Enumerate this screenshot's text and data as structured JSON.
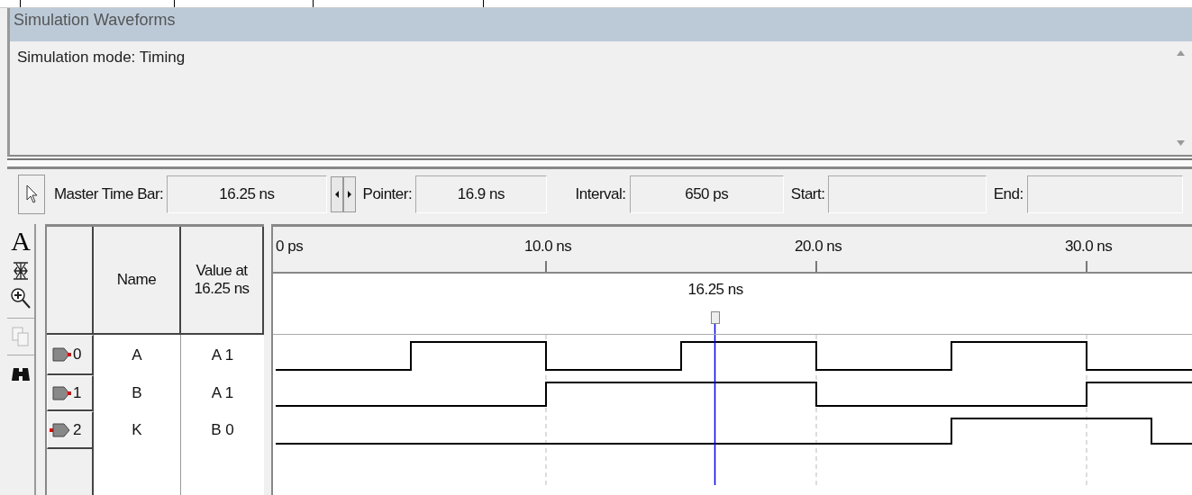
{
  "panel": {
    "title": "Simulation Waveforms"
  },
  "messages": [
    "Simulation mode: Timing"
  ],
  "time_bar": {
    "master_label": "Master Time Bar:",
    "master_value": "16.25 ns",
    "pointer_label": "Pointer:",
    "pointer_value": "16.9 ns",
    "interval_label": "Interval:",
    "interval_value": "650 ps",
    "start_label": "Start:",
    "end_label": "End:"
  },
  "tools": [
    {
      "kind": "text",
      "label": "A",
      "disabled": false
    },
    {
      "kind": "snap",
      "disabled": false
    },
    {
      "kind": "zoom",
      "disabled": false
    },
    {
      "kind": "copy",
      "disabled": true
    },
    {
      "kind": "find",
      "disabled": false
    }
  ],
  "table": {
    "columns": [
      "Name",
      "Value at 16.25 ns"
    ]
  },
  "signals": [
    {
      "index": "0",
      "name": "A",
      "value": "A 1",
      "kind": "input"
    },
    {
      "index": "1",
      "name": "B",
      "value": "A 1",
      "kind": "input"
    },
    {
      "index": "2",
      "name": "K",
      "value": "B 0",
      "kind": "output"
    }
  ],
  "timeline": {
    "ticks": [
      "0 ps",
      "10.0 ns",
      "20.0 ns",
      "30.0 ns"
    ],
    "cursor_label": "16.25 ns"
  }
}
